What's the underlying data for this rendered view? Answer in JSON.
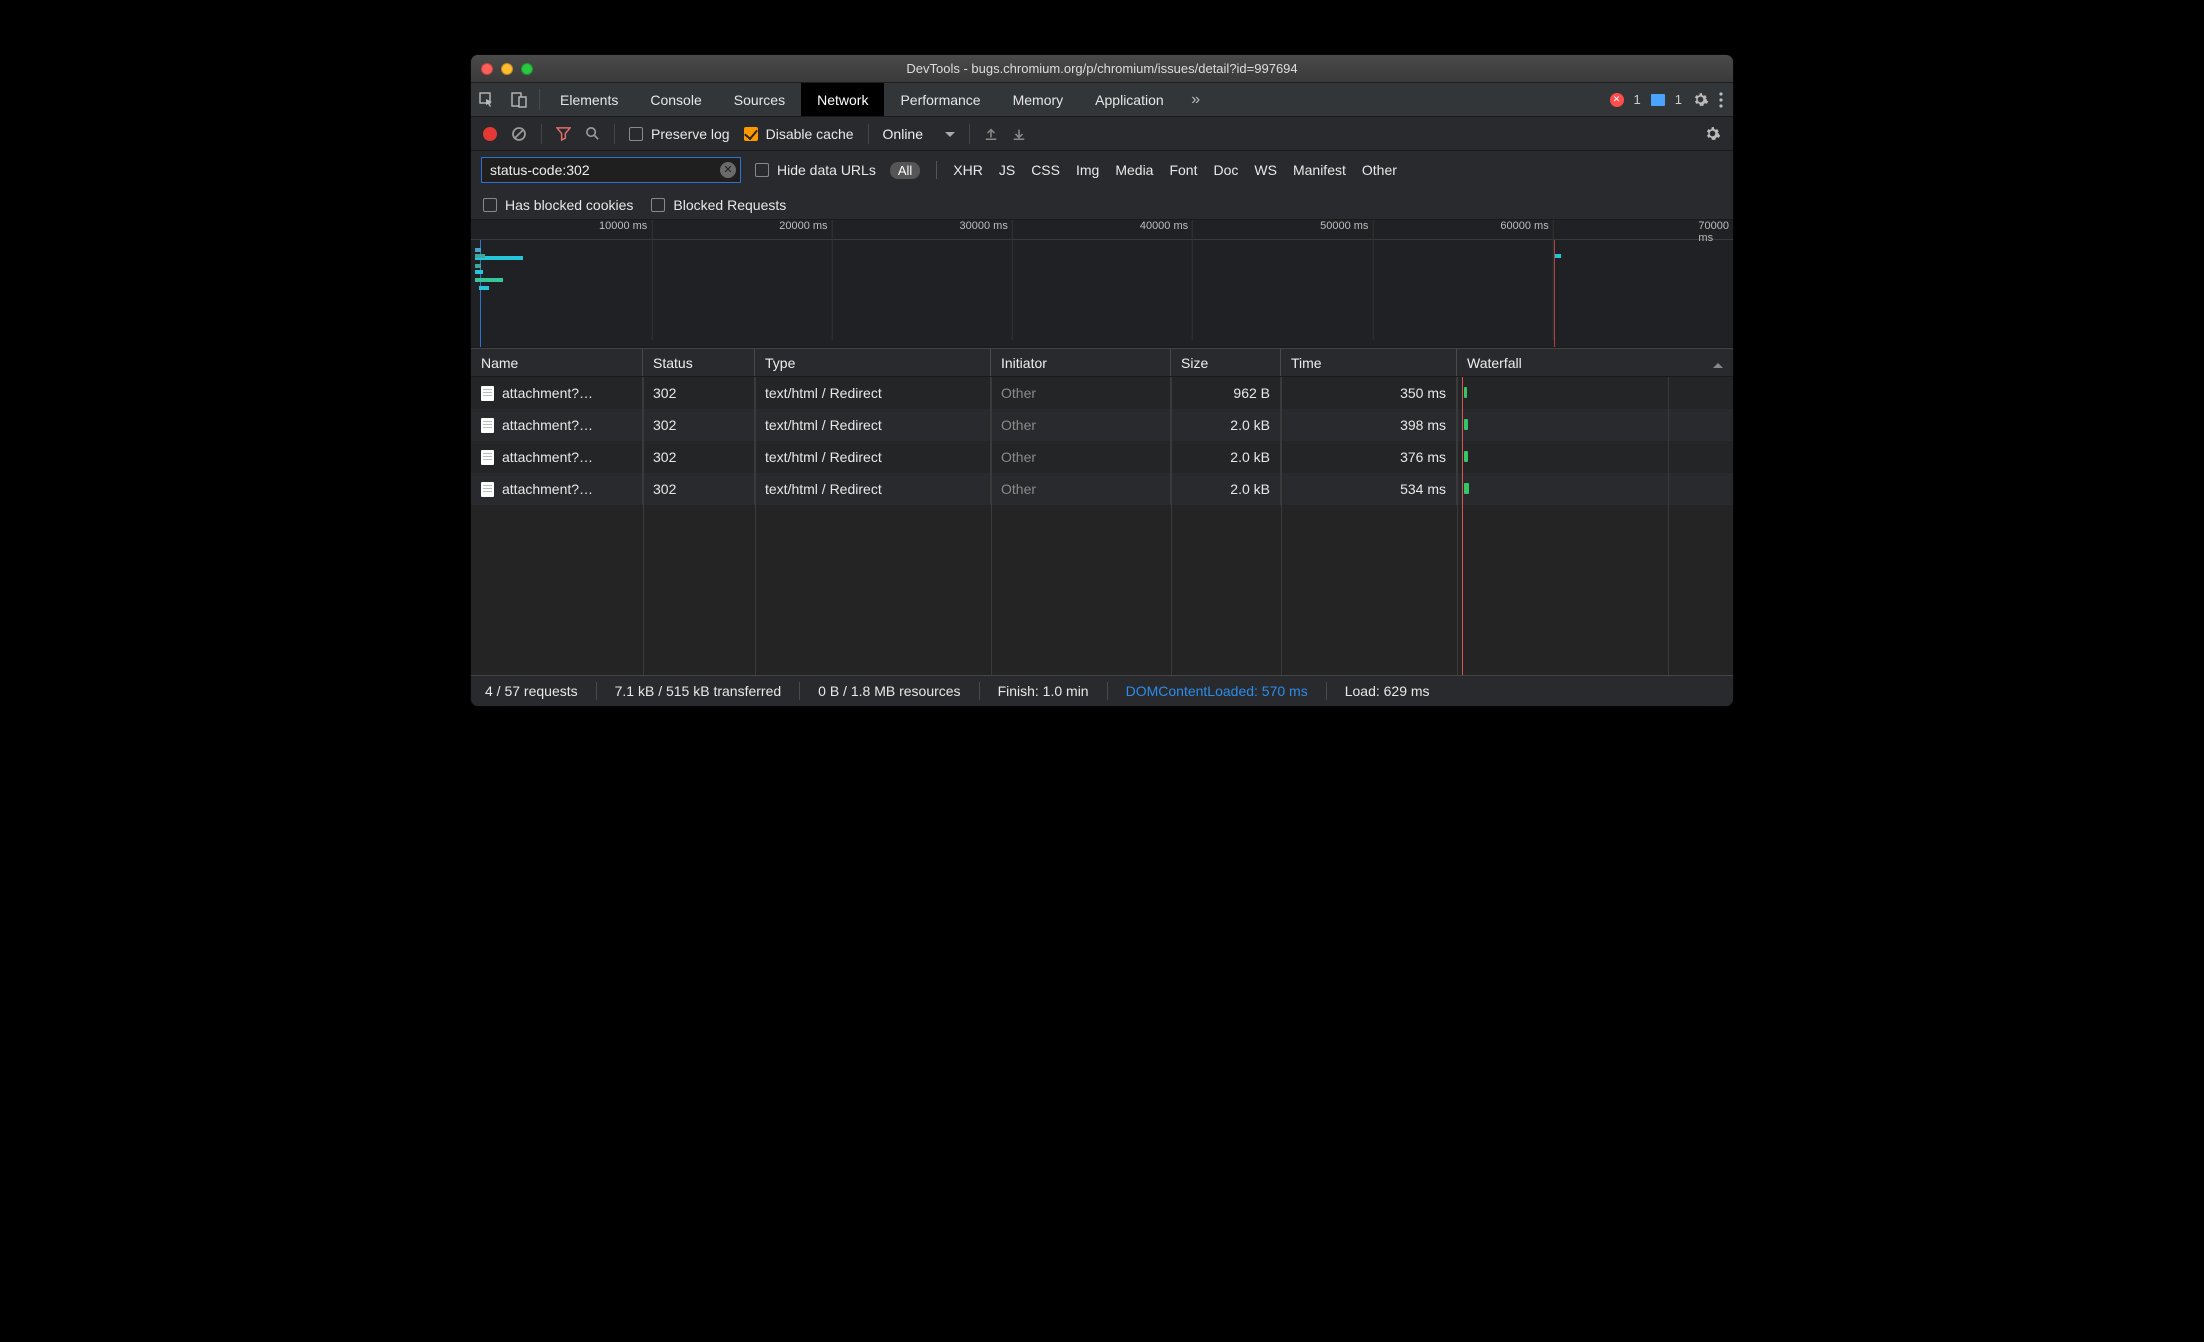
{
  "window": {
    "title": "DevTools - bugs.chromium.org/p/chromium/issues/detail?id=997694"
  },
  "tabs": {
    "items": [
      "Elements",
      "Console",
      "Sources",
      "Network",
      "Performance",
      "Memory",
      "Application"
    ],
    "activeIndex": 3,
    "overflow_glyph": "»",
    "errors_count": "1",
    "messages_count": "1"
  },
  "toolbar": {
    "preserve_log_label": "Preserve log",
    "preserve_log_checked": false,
    "disable_cache_label": "Disable cache",
    "disable_cache_checked": true,
    "throttling_value": "Online"
  },
  "filter": {
    "value": "status-code:302",
    "hide_data_urls_label": "Hide data URLs",
    "hide_data_urls_checked": false,
    "types_all_label": "All",
    "types": [
      "XHR",
      "JS",
      "CSS",
      "Img",
      "Media",
      "Font",
      "Doc",
      "WS",
      "Manifest",
      "Other"
    ],
    "has_blocked_cookies_label": "Has blocked cookies",
    "has_blocked_cookies_checked": false,
    "blocked_requests_label": "Blocked Requests",
    "blocked_requests_checked": false
  },
  "overview": {
    "ticks": [
      "10000 ms",
      "20000 ms",
      "30000 ms",
      "40000 ms",
      "50000 ms",
      "60000 ms",
      "70000 ms"
    ]
  },
  "columns": {
    "name": "Name",
    "status": "Status",
    "type": "Type",
    "initiator": "Initiator",
    "size": "Size",
    "time": "Time",
    "waterfall": "Waterfall"
  },
  "requests": [
    {
      "name": "attachment?…",
      "status": "302",
      "type": "text/html / Redirect",
      "initiator": "Other",
      "size": "962 B",
      "time": "350 ms"
    },
    {
      "name": "attachment?…",
      "status": "302",
      "type": "text/html / Redirect",
      "initiator": "Other",
      "size": "2.0 kB",
      "time": "398 ms"
    },
    {
      "name": "attachment?…",
      "status": "302",
      "type": "text/html / Redirect",
      "initiator": "Other",
      "size": "2.0 kB",
      "time": "376 ms"
    },
    {
      "name": "attachment?…",
      "status": "302",
      "type": "text/html / Redirect",
      "initiator": "Other",
      "size": "2.0 kB",
      "time": "534 ms"
    }
  ],
  "status": {
    "requests": "4 / 57 requests",
    "transferred": "7.1 kB / 515 kB transferred",
    "resources": "0 B / 1.8 MB resources",
    "finish": "Finish: 1.0 min",
    "dom": "DOMContentLoaded: 570 ms",
    "load": "Load: 629 ms"
  }
}
